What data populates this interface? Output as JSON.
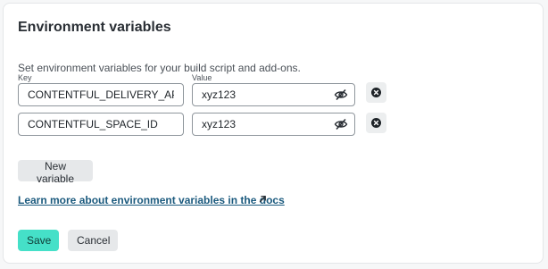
{
  "section": {
    "title": "Environment variables",
    "description": "Set environment variables for your build script and add-ons."
  },
  "labels": {
    "key": "Key",
    "value": "Value"
  },
  "variables": [
    {
      "key": "CONTENTFUL_DELIVERY_API_KEY",
      "value": "xyz123"
    },
    {
      "key": "CONTENTFUL_SPACE_ID",
      "value": "xyz123"
    }
  ],
  "icons": {
    "visibility": "eye-slash-icon",
    "remove": "close-circle-icon",
    "external": "arrow-up-right-icon"
  },
  "actions": {
    "new_variable": "New variable",
    "docs_link": "Learn more about environment variables in the docs",
    "save": "Save",
    "cancel": "Cancel"
  },
  "colors": {
    "save_button": "#45e0c8",
    "link": "#1b5a7e"
  }
}
